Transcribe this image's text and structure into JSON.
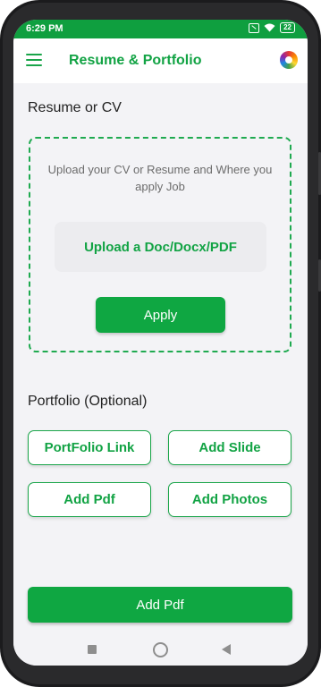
{
  "status_bar": {
    "time": "6:29 PM",
    "battery": "22"
  },
  "app_bar": {
    "title": "Resume & Portfolio",
    "menu_icon": "hamburger-menu-icon",
    "theme_icon": "color-wheel-icon"
  },
  "resume": {
    "title": "Resume or CV",
    "hint": "Upload your CV or Resume and Where you apply Job",
    "upload_label": "Upload a Doc/Docx/PDF",
    "apply_label": "Apply"
  },
  "portfolio": {
    "title": "Portfolio (Optional)",
    "buttons": [
      "PortFolio Link",
      "Add Slide",
      "Add Pdf",
      "Add Photos"
    ]
  },
  "footer": {
    "primary_label": "Add Pdf"
  },
  "colors": {
    "accent": "#0fa742",
    "text_accent": "#12a344",
    "background": "#f3f3f6"
  }
}
